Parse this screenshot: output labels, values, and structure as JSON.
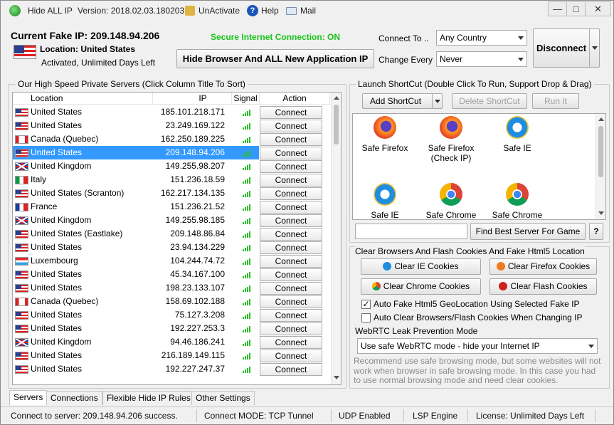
{
  "window": {
    "app_name": "Hide ALL IP",
    "version": "Version: 2018.02.03.180203",
    "unactivate": "UnActivate",
    "help": "Help",
    "mail": "Mail"
  },
  "header": {
    "current_ip": "Current Fake IP: 209.148.94.206",
    "location": "Location: United States",
    "activation": "Activated, Unlimited Days Left",
    "secure_status": "Secure Internet Connection: ON",
    "hide_button": "Hide Browser And ALL New Application IP",
    "connect_to_label": "Connect To ..",
    "connect_to_value": "Any Country",
    "change_every_label": "Change Every",
    "change_every_value": "Never",
    "disconnect_label": "Disconnect"
  },
  "servers": {
    "group_title": "Our High Speed Private Servers (Click Column Title To Sort)",
    "columns": [
      "Location",
      "IP",
      "Signal",
      "Action"
    ],
    "action_label": "Connect",
    "rows": [
      {
        "location": "United States",
        "ip": "185.101.218.171",
        "flag": "us",
        "signal": 4
      },
      {
        "location": "United States",
        "ip": "23.249.169.122",
        "flag": "us",
        "signal": 4
      },
      {
        "location": "Canada (Quebec)",
        "ip": "162.250.189.225",
        "flag": "ca",
        "signal": 4
      },
      {
        "location": "United States",
        "ip": "209.148.94.206",
        "flag": "us",
        "signal": 4,
        "selected": true
      },
      {
        "location": "United Kingdom",
        "ip": "149.255.98.207",
        "flag": "uk",
        "signal": 4
      },
      {
        "location": "Italy",
        "ip": "151.236.18.59",
        "flag": "it",
        "signal": 4
      },
      {
        "location": "United States (Scranton)",
        "ip": "162.217.134.135",
        "flag": "us",
        "signal": 4
      },
      {
        "location": "France",
        "ip": "151.236.21.52",
        "flag": "fr",
        "signal": 4
      },
      {
        "location": "United Kingdom",
        "ip": "149.255.98.185",
        "flag": "uk",
        "signal": 4
      },
      {
        "location": "United States (Eastlake)",
        "ip": "209.148.86.84",
        "flag": "us",
        "signal": 4
      },
      {
        "location": "United States",
        "ip": "23.94.134.229",
        "flag": "us",
        "signal": 4
      },
      {
        "location": "Luxembourg",
        "ip": "104.244.74.72",
        "flag": "lu",
        "signal": 4
      },
      {
        "location": "United States",
        "ip": "45.34.167.100",
        "flag": "us",
        "signal": 4
      },
      {
        "location": "United States",
        "ip": "198.23.133.107",
        "flag": "us",
        "signal": 4
      },
      {
        "location": "Canada (Quebec)",
        "ip": "158.69.102.188",
        "flag": "ca",
        "signal": 4
      },
      {
        "location": "United States",
        "ip": "75.127.3.208",
        "flag": "us",
        "signal": 4
      },
      {
        "location": "United States",
        "ip": "192.227.253.3",
        "flag": "us",
        "signal": 4
      },
      {
        "location": "United Kingdom",
        "ip": "94.46.186.241",
        "flag": "uk",
        "signal": 4
      },
      {
        "location": "United States",
        "ip": "216.189.149.115",
        "flag": "us",
        "signal": 4
      },
      {
        "location": "United States",
        "ip": "192.227.247.37",
        "flag": "us",
        "signal": 4
      }
    ]
  },
  "shortcuts": {
    "group_title": "Launch ShortCut (Double Click To Run, Support Drop & Drag)",
    "add_label": "Add ShortCut",
    "delete_label": "Delete ShortCut",
    "run_label": "Run It",
    "items": [
      {
        "label": "Safe Firefox",
        "icon": "firefox-icon"
      },
      {
        "label": "Safe Firefox (Check IP)",
        "icon": "firefox-icon"
      },
      {
        "label": "Safe IE",
        "icon": "ie-icon"
      },
      {
        "label": "Safe IE (Check",
        "icon": "ie-icon"
      },
      {
        "label": "Safe Chrome",
        "icon": "chrome-icon"
      },
      {
        "label": "Safe Chrome",
        "icon": "chrome-icon"
      }
    ],
    "search_value": "",
    "find_best_label": "Find Best Server For Game",
    "help_label": "?"
  },
  "cookies": {
    "group_title": "Clear Browsers And Flash Cookies And Fake Html5 Location",
    "clear_ie": "Clear IE Cookies",
    "clear_firefox": "Clear Firefox Cookies",
    "clear_chrome": "Clear Chrome Cookies",
    "clear_flash": "Clear Flash Cookies",
    "auto_fake_html5": "Auto Fake Html5 GeoLocation Using Selected Fake IP",
    "auto_fake_html5_checked": true,
    "auto_clear": "Auto Clear Browsers/Flash Cookies When Changing IP",
    "auto_clear_checked": false,
    "webrtc_label": "WebRTC Leak Prevention Mode",
    "webrtc_value": "Use safe WebRTC mode - hide your Internet IP",
    "note": "Recommend use safe browsing mode, but some websites will not work when browser in safe browsing mode. In this case you had to use normal browsing mode and need clear cookies."
  },
  "tabs": [
    "Servers",
    "Connections",
    "Flexible Hide IP Rules",
    "Other Settings"
  ],
  "status": {
    "connect": "Connect to server: 209.148.94.206 success.",
    "mode": "Connect MODE: TCP Tunnel",
    "udp": "UDP Enabled",
    "lsp": "LSP Engine",
    "license": "License: Unlimited Days Left"
  },
  "colors": {
    "secure_green": "#19c419",
    "selection_blue": "#3399ff",
    "signal_green": "#26c226"
  }
}
